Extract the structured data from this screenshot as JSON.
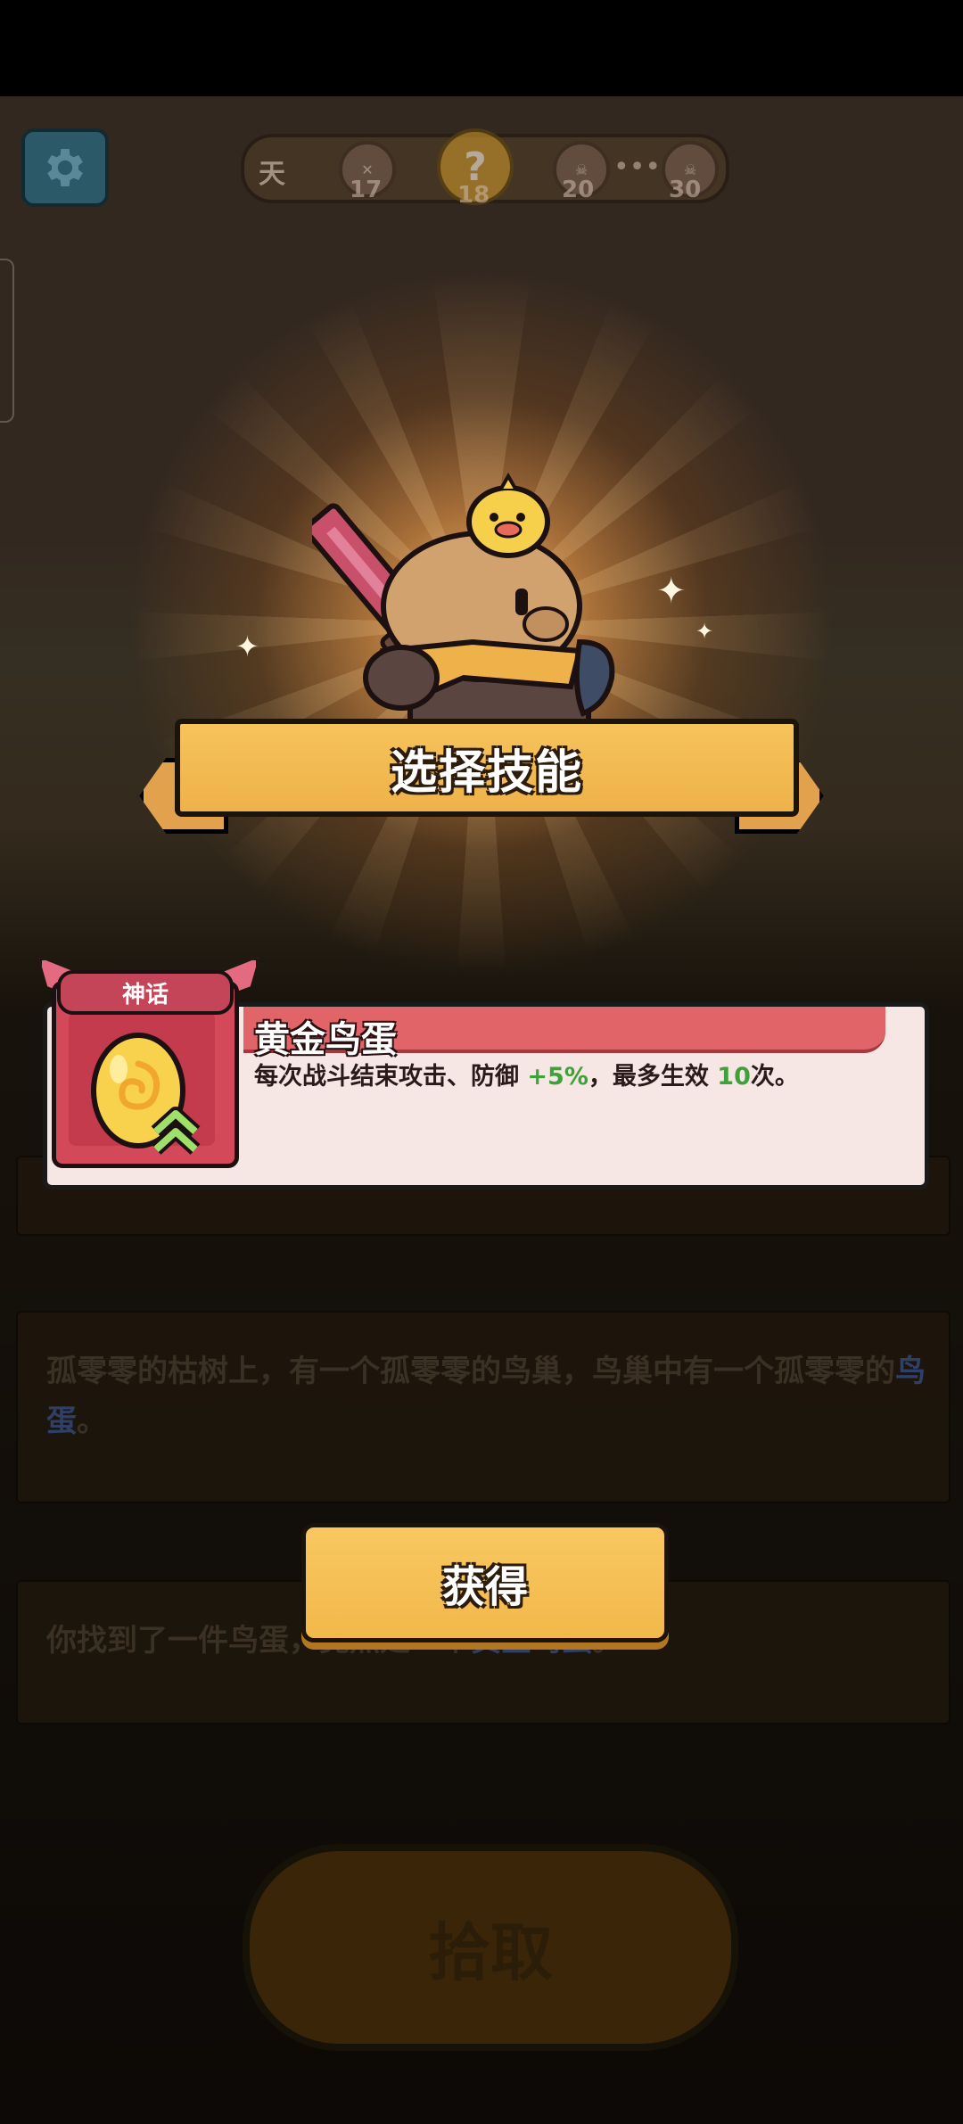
{
  "hud": {
    "day_label": "天",
    "stages": [
      "17",
      "18",
      "20",
      "30"
    ]
  },
  "modal": {
    "title": "选择技能",
    "confirm_label": "获得"
  },
  "skill": {
    "rarity": "神话",
    "name": "黄金鸟蛋",
    "desc_part1": "每次战斗结束攻击、防御 ",
    "desc_value1": "+5%",
    "desc_part2": "，最多生效 ",
    "desc_value2": "10",
    "desc_part3": "次。",
    "colors": {
      "name_band": "#e06468",
      "value_green": "#3fa13a",
      "card_bg": "#f6e6e4"
    }
  },
  "story": {
    "paragraph1_prefix": "孤零零的枯树上，有一个孤零零的鸟巢，鸟巢中有一个孤零零的",
    "paragraph1_highlight": "鸟蛋",
    "paragraph1_suffix": "。",
    "paragraph2_prefix": "你找到了一件鸟蛋，竟然是一个",
    "paragraph2_highlight": "黄金鸟蛋",
    "paragraph2_suffix": "。"
  },
  "actions": {
    "pickup_label": "拾取"
  },
  "icons": [
    "gear-icon",
    "golden-egg-icon",
    "sparkle-icon",
    "skull-icon",
    "question-icon"
  ]
}
